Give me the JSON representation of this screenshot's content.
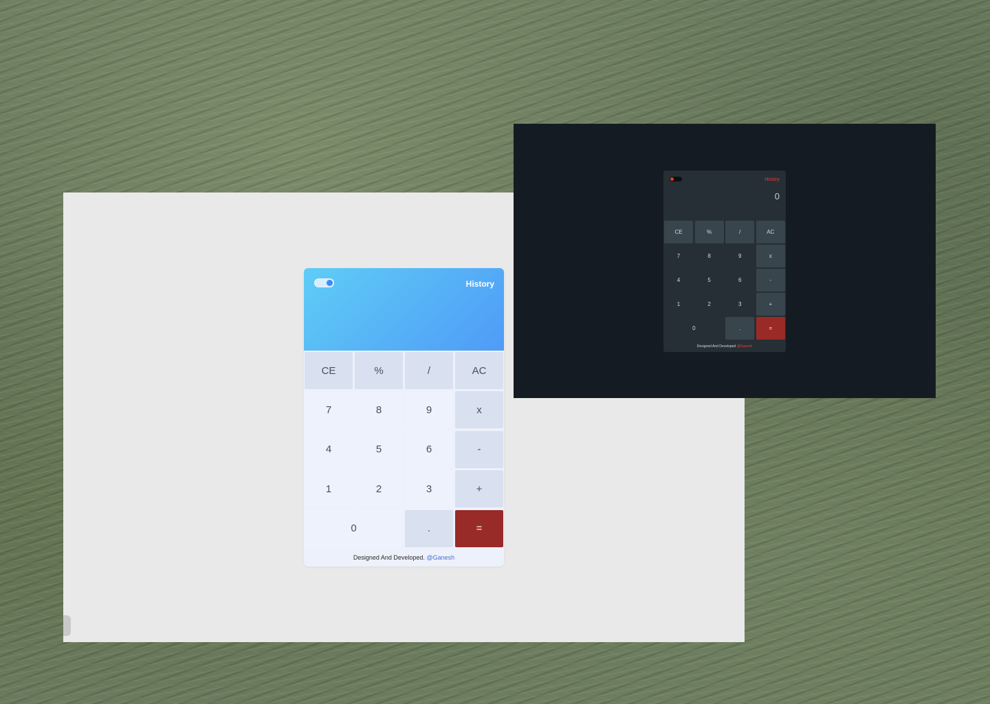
{
  "light_calculator": {
    "history_label": "History",
    "theme_toggle_on": true,
    "display_value": "",
    "keys": [
      "CE",
      "%",
      "/",
      "AC",
      "7",
      "8",
      "9",
      "x",
      "4",
      "5",
      "6",
      "-",
      "1",
      "2",
      "3",
      "+",
      "0",
      ".",
      "="
    ],
    "footer_text": "Designed And Developed.",
    "footer_author": "@Ganesh",
    "colors": {
      "display_gradient_start": "#5fcdf6",
      "display_gradient_end": "#4f9bf7",
      "equals": "#982a27",
      "author_link": "#4a6fd1"
    }
  },
  "dark_calculator": {
    "history_label": "History",
    "theme_toggle_on": false,
    "display_value": "0",
    "keys": [
      "CE",
      "%",
      "/",
      "AC",
      "7",
      "8",
      "9",
      "x",
      "4",
      "5",
      "6",
      "-",
      "1",
      "2",
      "3",
      "+",
      "0",
      ".",
      "="
    ],
    "footer_text": "Designed And Developed",
    "footer_author": "@Ganesh",
    "colors": {
      "background": "#151b22",
      "body": "#252f35",
      "equals": "#9a2a26",
      "accent": "#e0403a"
    }
  }
}
